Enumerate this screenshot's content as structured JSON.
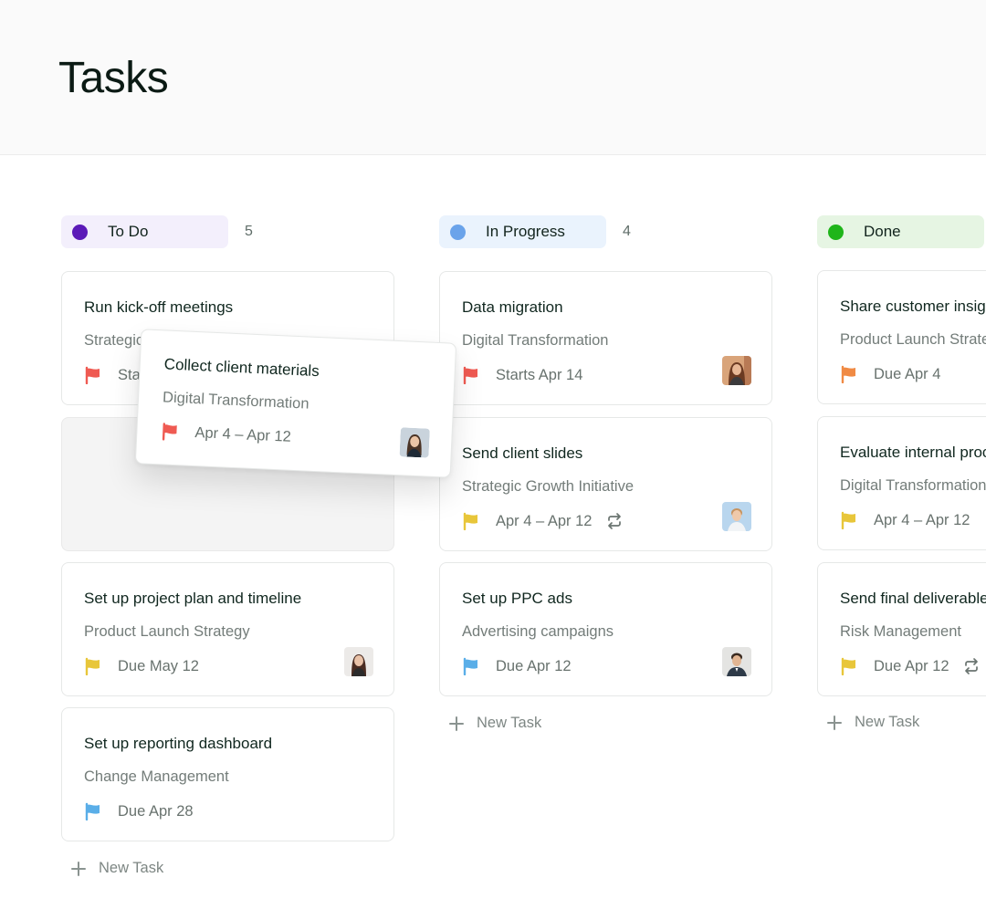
{
  "page": {
    "title": "Tasks"
  },
  "colors": {
    "red_flag": "#ef5a52",
    "yellow_flag": "#e8c63a",
    "blue_flag": "#5aaee8",
    "orange_flag": "#f08a44",
    "todo": "#5b1ab8",
    "in_progress": "#6aa3ea",
    "done": "#1fb51a"
  },
  "columns": [
    {
      "label": "To Do",
      "count": "5",
      "cards": [
        {
          "title": "Run kick-off meetings",
          "project": "Strategic Growth Initiative",
          "date": "Starts Apr 14",
          "flag": "red-flag-icon"
        },
        {
          "title": "Set up project plan and timeline",
          "project": "Product Launch Strategy",
          "date": "Due May 12",
          "flag": "yellow-flag-icon"
        },
        {
          "title": "Set up reporting dashboard",
          "project": "Change Management",
          "date": "Due Apr 28",
          "flag": "blue-flag-icon"
        }
      ],
      "new_task": "New Task"
    },
    {
      "label": "In Progress",
      "count": "4",
      "cards": [
        {
          "title": "Data migration",
          "project": "Digital Transformation",
          "date": "Starts Apr 14",
          "flag": "red-flag-icon"
        },
        {
          "title": "Send client slides",
          "project": "Strategic Growth Initiative",
          "date": "Apr 4 – Apr 12",
          "flag": "yellow-flag-icon",
          "repeat": "repeat-icon"
        },
        {
          "title": "Set up PPC ads",
          "project": "Advertising campaigns",
          "date": "Due Apr 12",
          "flag": "blue-flag-icon"
        }
      ],
      "new_task": "New Task"
    },
    {
      "label": "Done",
      "cards": [
        {
          "title": "Share customer insights",
          "project": "Product Launch Strategy",
          "date": "Due Apr 4",
          "flag": "orange-flag-icon"
        },
        {
          "title": "Evaluate internal processes",
          "project": "Digital Transformation",
          "date": "Apr 4 – Apr 12",
          "flag": "yellow-flag-icon"
        },
        {
          "title": "Send final deliverables",
          "project": "Risk Management",
          "date": "Due Apr 12",
          "flag": "yellow-flag-icon",
          "repeat": "repeat-icon"
        }
      ],
      "new_task": "New Task"
    }
  ],
  "dragging_card": {
    "title": "Collect client materials",
    "project": "Digital Transformation",
    "date": "Apr 4 – Apr 12",
    "flag": "red-flag-icon"
  }
}
